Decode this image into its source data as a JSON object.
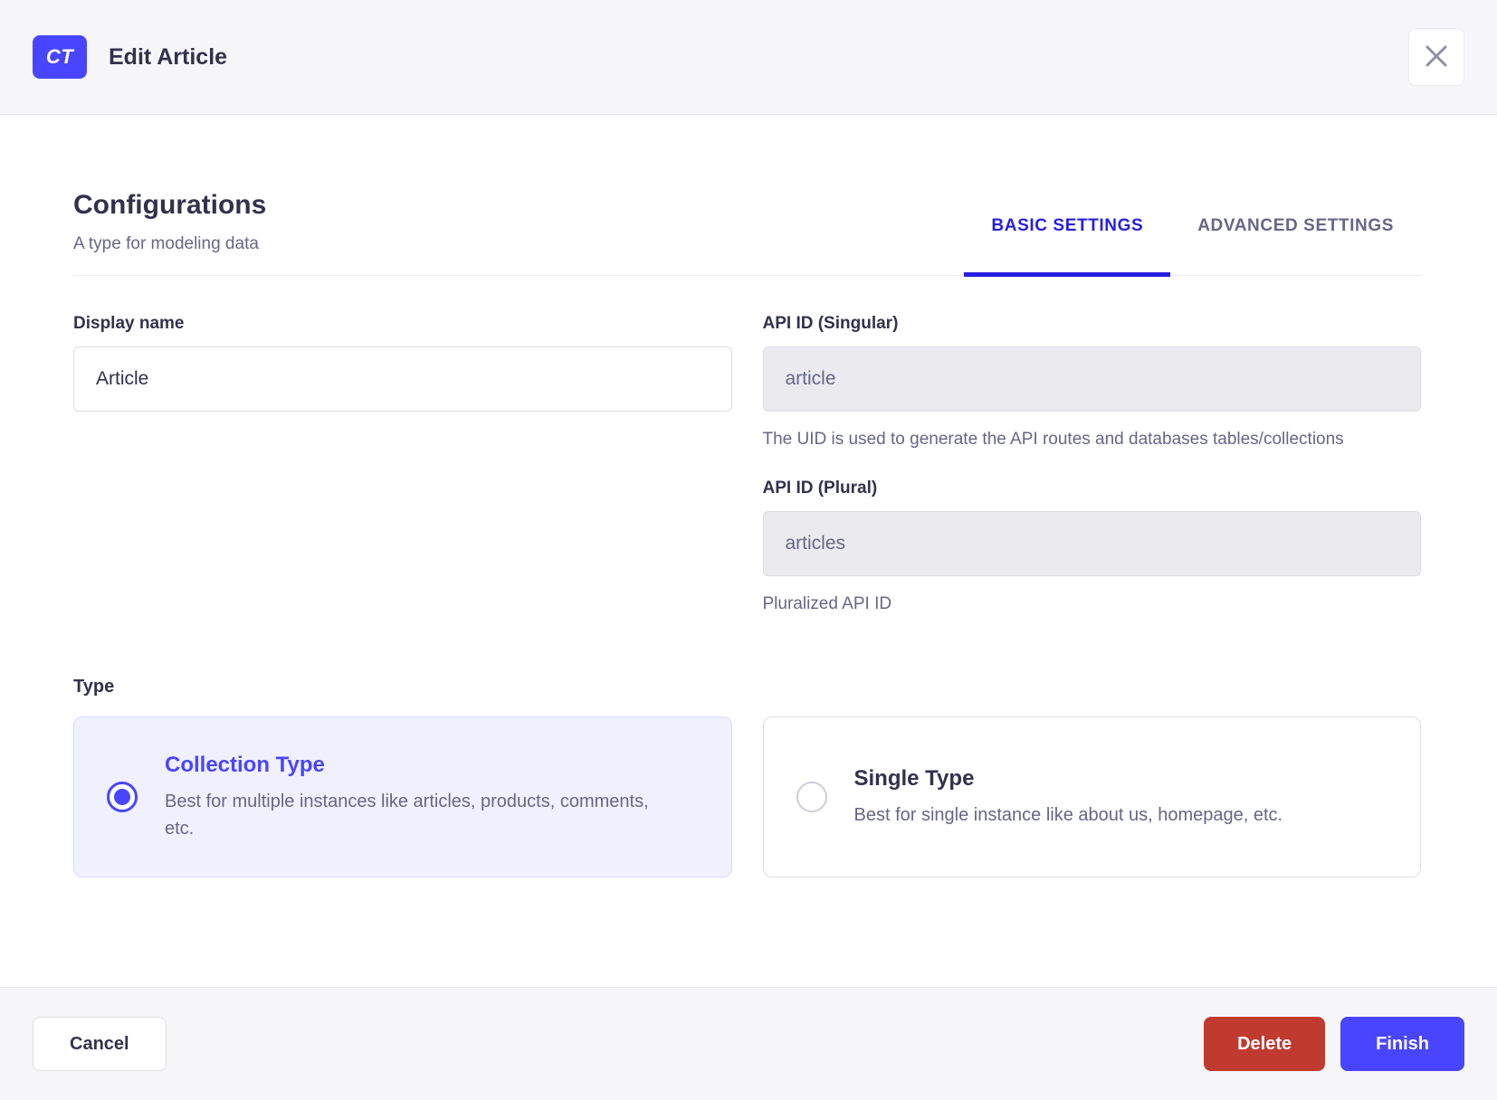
{
  "header": {
    "badge": "CT",
    "title": "Edit Article"
  },
  "section": {
    "title": "Configurations",
    "subtitle": "A type for modeling data",
    "tabs": [
      {
        "label": "BASIC SETTINGS",
        "active": true
      },
      {
        "label": "ADVANCED SETTINGS",
        "active": false
      }
    ]
  },
  "form": {
    "display_name": {
      "label": "Display name",
      "value": "Article"
    },
    "api_id_singular": {
      "label": "API ID (Singular)",
      "value": "article",
      "disabled": true,
      "helper": "The UID is used to generate the API routes and databases tables/collections"
    },
    "api_id_plural": {
      "label": "API ID (Plural)",
      "value": "articles",
      "disabled": true,
      "helper": "Pluralized API ID"
    },
    "type": {
      "label": "Type",
      "options": [
        {
          "title": "Collection Type",
          "description": "Best for multiple instances like articles, products, comments, etc.",
          "selected": true
        },
        {
          "title": "Single Type",
          "description": "Best for single instance like about us, homepage, etc.",
          "selected": false
        }
      ]
    }
  },
  "footer": {
    "cancel_label": "Cancel",
    "delete_label": "Delete",
    "finish_label": "Finish"
  },
  "colors": {
    "primary_indigo": "#4945FF",
    "tab_active_blue": "#271FE0",
    "danger_red": "#C13A2F",
    "heading_text": "#32324D",
    "muted_text": "#666687",
    "header_footer_bg": "#F6F6F9",
    "divider": "#EAEAEF",
    "input_border": "#DCDCE4",
    "disabled_input_bg": "#EAEAEF",
    "selected_card_bg": "#F0F0FF",
    "selected_card_border": "#D9D8FF"
  }
}
